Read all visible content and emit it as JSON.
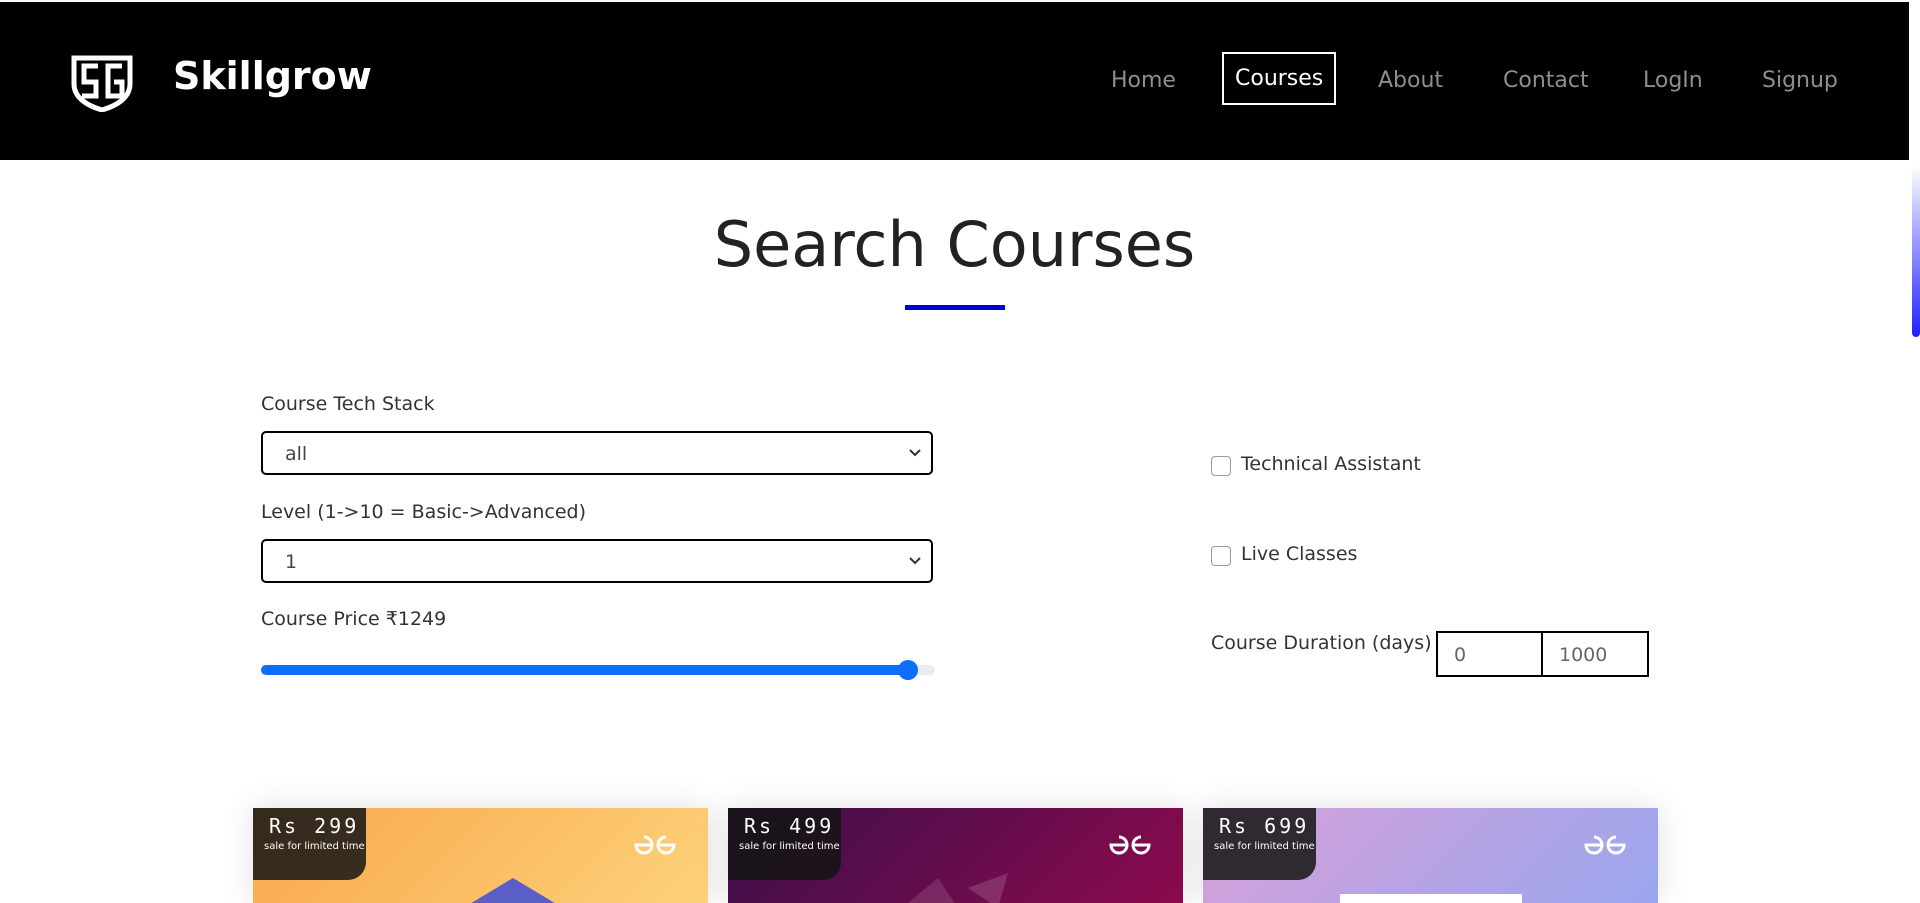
{
  "brand": {
    "name": "Skillgrow",
    "logo_icon": "sg-shield-logo-icon"
  },
  "nav": {
    "items": [
      {
        "label": "Home",
        "active": false
      },
      {
        "label": "Courses",
        "active": true
      },
      {
        "label": "About",
        "active": false
      },
      {
        "label": "Contact",
        "active": false
      },
      {
        "label": "LogIn",
        "active": false
      },
      {
        "label": "Signup",
        "active": false
      }
    ]
  },
  "page": {
    "title": "Search Courses",
    "accent_color": "#0000d6"
  },
  "filters": {
    "tech_stack": {
      "label": "Course Tech Stack",
      "value": "all"
    },
    "level": {
      "label": "Level (1->10 = Basic->Advanced)",
      "value": "1"
    },
    "price": {
      "label": "Course Price ₹1249",
      "fraction": 0.96
    },
    "technical_assistant": {
      "label": "Technical Assistant",
      "checked": false
    },
    "live_classes": {
      "label": "Live Classes",
      "checked": false
    },
    "duration": {
      "label": "Course Duration (days)",
      "min": "0",
      "max": "1000"
    }
  },
  "courses": [
    {
      "price": "Rs 299",
      "sale": "sale for limited time"
    },
    {
      "price": "Rs 499",
      "sale": "sale for limited time"
    },
    {
      "price": "Rs 699",
      "sale": "sale for limited time"
    }
  ],
  "colors": {
    "slider": "#0d6efd",
    "nav_bg": "#000000"
  }
}
